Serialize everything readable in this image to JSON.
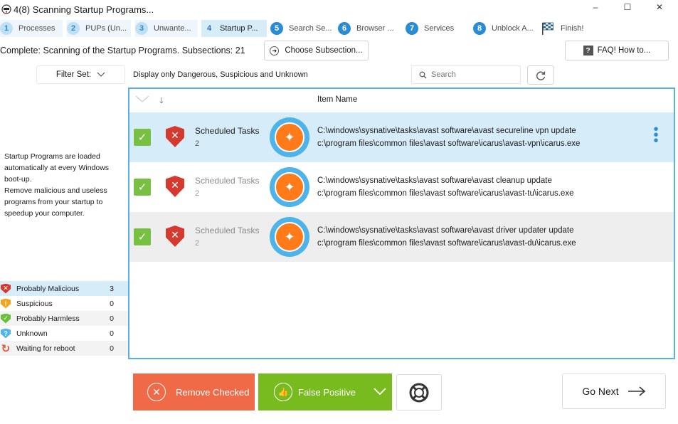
{
  "window": {
    "title": "4(8) Scanning Startup Programs...",
    "minimize_glyph": "–",
    "maximize_glyph": "☐",
    "close_glyph": "✕"
  },
  "steps": [
    {
      "num": "1",
      "label": "Processes",
      "state": "done"
    },
    {
      "num": "2",
      "label": "PUPs (Un...",
      "state": "done"
    },
    {
      "num": "3",
      "label": "Unwante...",
      "state": "done"
    },
    {
      "num": "4",
      "label": "Startup P...",
      "state": "current"
    },
    {
      "num": "5",
      "label": "Search Se...",
      "state": "todo"
    },
    {
      "num": "6",
      "label": "Browser ...",
      "state": "todo"
    },
    {
      "num": "7",
      "label": "Services",
      "state": "todo"
    },
    {
      "num": "8",
      "label": "Unblock A...",
      "state": "todo"
    },
    {
      "num": "",
      "label": "Finish!",
      "state": "finish",
      "icon": "checkered-flag-icon"
    }
  ],
  "status": {
    "text": "Complete: Scanning of the Startup Programs. Subsections: 21",
    "choose_subsection_label": "Choose Subsection...",
    "faq_label": "FAQ! How to..."
  },
  "filter": {
    "filter_set_label": "Filter Set:",
    "display_only": "Display only Dangerous, Suspicious and Unknown",
    "search_placeholder": "Search"
  },
  "left_panel": {
    "description_lines": [
      "Startup Programs are loaded",
      "automatically at every Windows",
      "boot-up.",
      "Remove malicious and useless",
      "programs from your startup to",
      "speedup your computer."
    ],
    "legend": [
      {
        "label": "Probably Malicious",
        "count": "3",
        "color": "#d43a2f",
        "icon": "malicious-shield-icon"
      },
      {
        "label": "Suspicious",
        "count": "0",
        "color": "#f3a31d",
        "icon": "suspicious-shield-icon"
      },
      {
        "label": "Probably Harmless",
        "count": "0",
        "color": "#6cbf3a",
        "icon": "harmless-shield-icon"
      },
      {
        "label": "Unknown",
        "count": "0",
        "color": "#4fb6e8",
        "icon": "unknown-shield-icon"
      },
      {
        "label": "Waiting for reboot",
        "count": "0",
        "color": "#e3542f",
        "icon": "reboot-icon"
      }
    ]
  },
  "table": {
    "header_item_name": "Item Name",
    "rows": [
      {
        "category": "Scheduled Tasks",
        "count": "2",
        "line1": "C:\\windows\\sysnative\\tasks\\avast software\\avast secureline vpn update",
        "line2": "c:\\program files\\common files\\avast software\\icarus\\avast-vpn\\icarus.exe"
      },
      {
        "category": "Scheduled Tasks",
        "count": "2",
        "line1": "C:\\windows\\sysnative\\tasks\\avast software\\avast cleanup update",
        "line2": "c:\\program files\\common files\\avast software\\icarus\\avast-tu\\icarus.exe"
      },
      {
        "category": "Scheduled Tasks",
        "count": "2",
        "line1": "C:\\windows\\sysnative\\tasks\\avast software\\avast driver updater update",
        "line2": "c:\\program files\\common files\\avast software\\icarus\\avast-du\\icarus.exe"
      }
    ]
  },
  "buttons": {
    "remove_checked": "Remove Checked",
    "false_positive": "False Positive",
    "go_next": "Go Next"
  },
  "colors": {
    "accent_blue": "#2a8cd4",
    "remove_orange": "#f06a47",
    "false_positive_green": "#78bb1f",
    "check_green": "#78c041",
    "danger_red": "#d43a2f"
  }
}
